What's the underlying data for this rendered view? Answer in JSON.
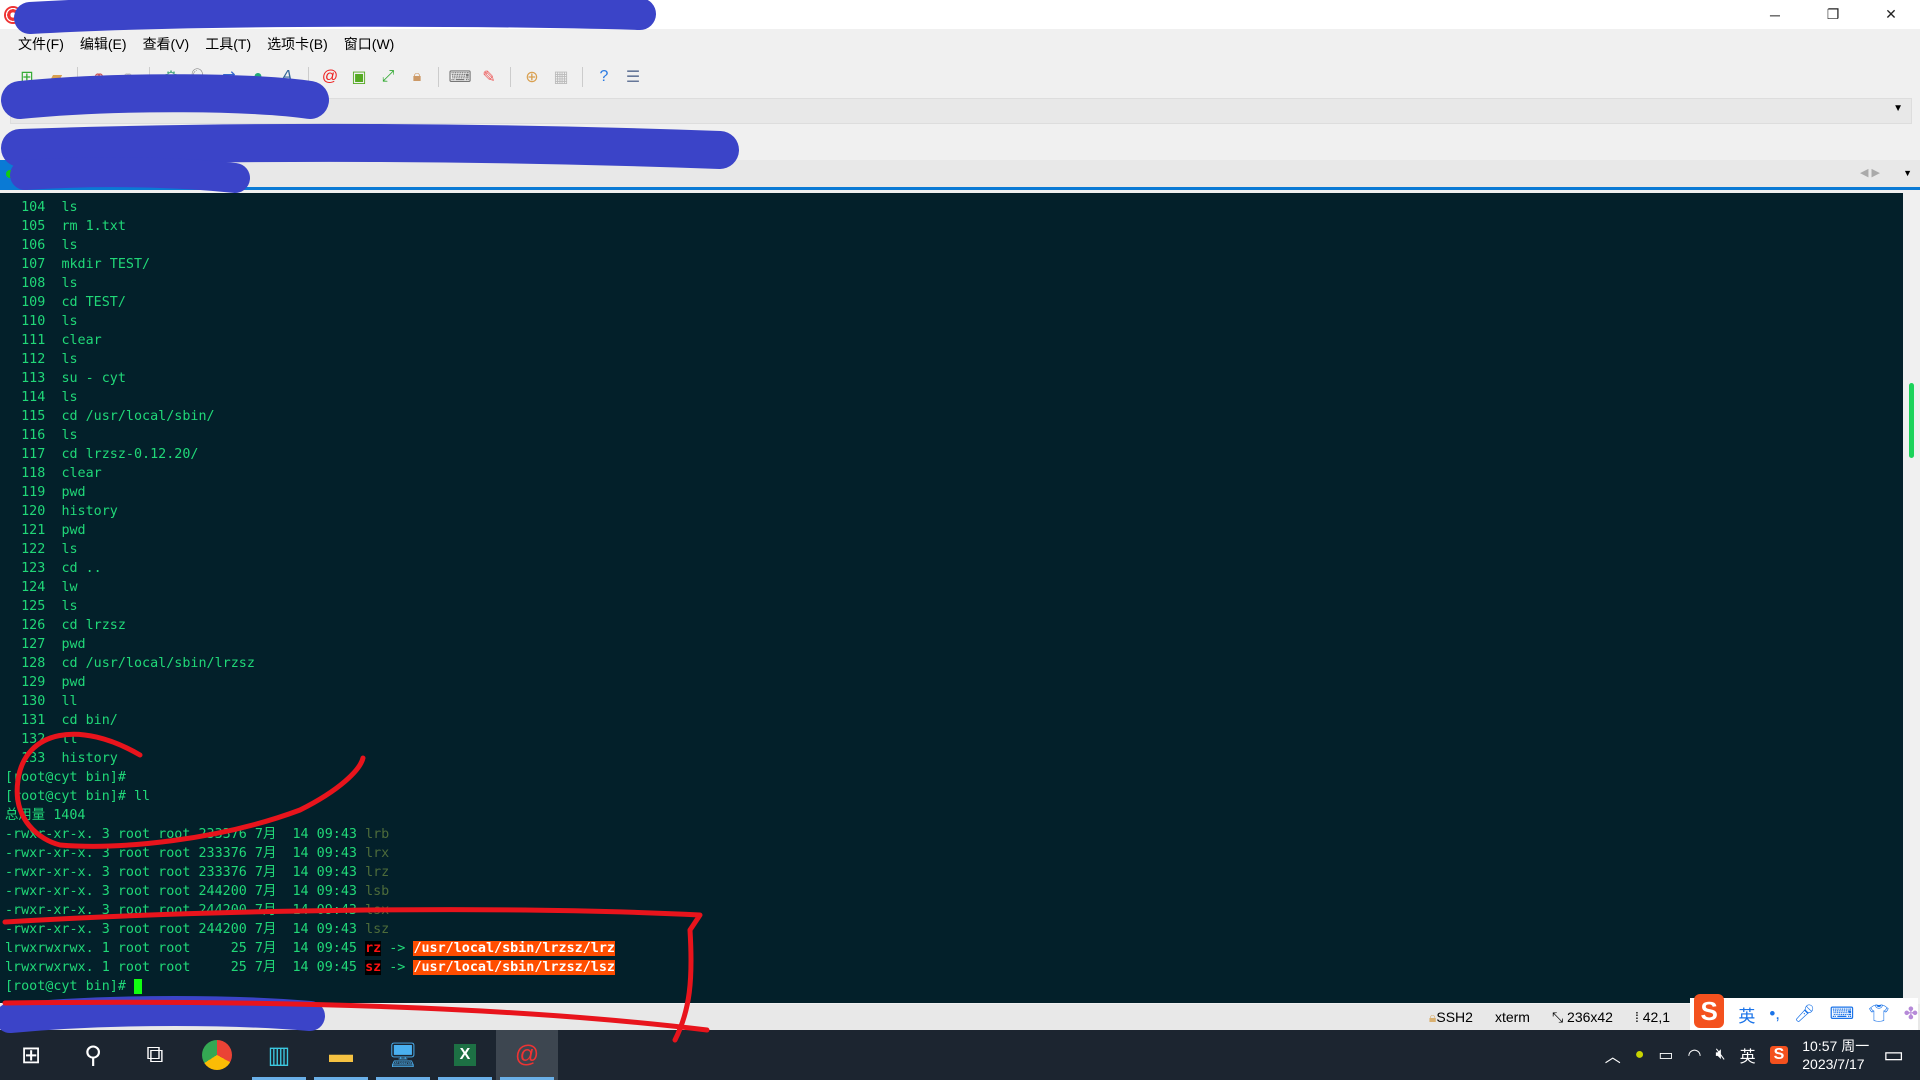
{
  "window": {
    "title": "",
    "controls": {
      "minimize": "─",
      "maximize": "❐",
      "close": "✕"
    }
  },
  "menu": [
    "文件(F)",
    "编辑(E)",
    "查看(V)",
    "工具(T)",
    "选项卡(B)",
    "窗口(W)"
  ],
  "toolbar_icons": [
    "new-session-icon",
    "open-folder-icon",
    "connect-icon",
    "disconnect-icon",
    "session-settings-icon",
    "find-icon",
    "transfer-icon",
    "globe-icon",
    "font-icon",
    "xshell-icon",
    "xftp-icon",
    "fullscreen-icon",
    "lock-icon",
    "keyboard-icon",
    "highlight-icon",
    "add-tab-icon",
    "layout-icon",
    "help-icon",
    "chat-icon"
  ],
  "terminal": {
    "history": [
      {
        "n": "104",
        "cmd": "ls"
      },
      {
        "n": "105",
        "cmd": "rm 1.txt"
      },
      {
        "n": "106",
        "cmd": "ls"
      },
      {
        "n": "107",
        "cmd": "mkdir TEST/"
      },
      {
        "n": "108",
        "cmd": "ls"
      },
      {
        "n": "109",
        "cmd": "cd TEST/"
      },
      {
        "n": "110",
        "cmd": "ls"
      },
      {
        "n": "111",
        "cmd": "clear"
      },
      {
        "n": "112",
        "cmd": "ls"
      },
      {
        "n": "113",
        "cmd": "su - cyt"
      },
      {
        "n": "114",
        "cmd": "ls"
      },
      {
        "n": "115",
        "cmd": "cd /usr/local/sbin/"
      },
      {
        "n": "116",
        "cmd": "ls"
      },
      {
        "n": "117",
        "cmd": "cd lrzsz-0.12.20/"
      },
      {
        "n": "118",
        "cmd": "clear"
      },
      {
        "n": "119",
        "cmd": "pwd"
      },
      {
        "n": "120",
        "cmd": "history"
      },
      {
        "n": "121",
        "cmd": "pwd"
      },
      {
        "n": "122",
        "cmd": "ls"
      },
      {
        "n": "123",
        "cmd": "cd .."
      },
      {
        "n": "124",
        "cmd": "lw"
      },
      {
        "n": "125",
        "cmd": "ls"
      },
      {
        "n": "126",
        "cmd": "cd lrzsz"
      },
      {
        "n": "127",
        "cmd": "pwd"
      },
      {
        "n": "128",
        "cmd": "cd /usr/local/sbin/lrzsz"
      },
      {
        "n": "129",
        "cmd": "pwd"
      },
      {
        "n": "130",
        "cmd": "ll"
      },
      {
        "n": "131",
        "cmd": "cd bin/"
      },
      {
        "n": "132",
        "cmd": "ll"
      },
      {
        "n": "133",
        "cmd": "history"
      }
    ],
    "prompt1": "[root@cyt bin]#",
    "prompt2": "[root@cyt bin]# ll",
    "total": "总用量 1404",
    "files": [
      {
        "meta": "-rwxr-xr-x. 3 root root 233376 7月  14 09:43 ",
        "name": "lrb"
      },
      {
        "meta": "-rwxr-xr-x. 3 root root 233376 7月  14 09:43 ",
        "name": "lrx"
      },
      {
        "meta": "-rwxr-xr-x. 3 root root 233376 7月  14 09:43 ",
        "name": "lrz"
      },
      {
        "meta": "-rwxr-xr-x. 3 root root 244200 7月  14 09:43 ",
        "name": "lsb"
      },
      {
        "meta": "-rwxr-xr-x. 3 root root 244200 7月  14 09:43 ",
        "name": "lsx"
      },
      {
        "meta": "-rwxr-xr-x. 3 root root 244200 7月  14 09:43 ",
        "name": "lsz"
      }
    ],
    "links": [
      {
        "meta": "lrwxrwxrwx. 1 root root     25 7月  14 09:45 ",
        "name": "rz",
        "arrow": " -> ",
        "target": "/usr/local/sbin/lrzsz/lrz"
      },
      {
        "meta": "lrwxrwxrwx. 1 root root     25 7月  14 09:45 ",
        "name": "sz",
        "arrow": " -> ",
        "target": "/usr/local/sbin/lrzsz/lsz"
      }
    ],
    "prompt3": "[root@cyt bin]# "
  },
  "status": {
    "protocol": "SSH2",
    "term": "xterm",
    "size": "236x42",
    "pos": "42,1"
  },
  "ime": {
    "logo": "S",
    "lang": "英",
    "punct": "•,"
  },
  "taskbar": {
    "apps": [
      "start",
      "search",
      "task-view",
      "chrome",
      "server-manager",
      "file-explorer",
      "network",
      "excel",
      "xshell"
    ],
    "tray_lang": "英",
    "time": "10:57 周一",
    "date": "2023/7/17"
  },
  "colors": {
    "terminal_bg": "#03202a",
    "terminal_fg": "#20d878",
    "accent": "#0a7ad5",
    "annotation": "#e8141c",
    "redaction": "#3b44c8"
  }
}
